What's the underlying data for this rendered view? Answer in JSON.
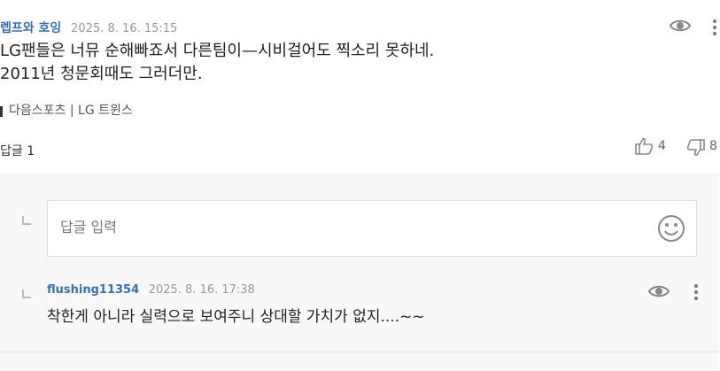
{
  "comment": {
    "author": "렙프와 호잉",
    "time": "2025. 8. 16. 15:15",
    "body_line1": "LG팬들은 너뮤 순해빠죠서 다른팀이—시비걸어도 찍소리 못하네.",
    "body_line2": "2011년 청문회때도 그러더만.",
    "source": "다음스포츠 | LG 트윈스",
    "reply_label": "답글",
    "reply_count": "1",
    "like_count": "4",
    "dislike_count": "8"
  },
  "reply_input": {
    "placeholder": "답글 입력"
  },
  "reply": {
    "author": "flushing11354",
    "time": "2025. 8. 16. 17:38",
    "body": "착한게 아니라  실력으로 보여주니  상대할 가치가 없지....~~"
  },
  "icons": {
    "view": "eye-icon",
    "more": "more-vertical-icon",
    "like": "thumbs-up-icon",
    "dislike": "thumbs-down-icon",
    "emoji": "smiley-icon",
    "reply_indent": "reply-indent-icon"
  },
  "colors": {
    "author": "#3a6fb0",
    "icon": "#888888",
    "reply_bg": "#f8f8f8"
  }
}
